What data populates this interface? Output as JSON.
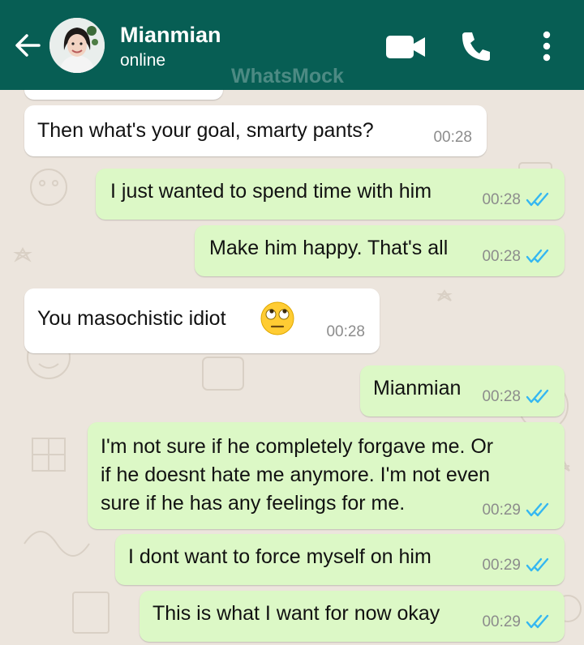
{
  "header": {
    "contact_name": "Mianmian",
    "status": "online",
    "watermark": "WhatsMock"
  },
  "icons": {
    "back": "arrow-left-icon",
    "video_call": "video-camera-icon",
    "voice_call": "phone-icon",
    "menu": "vertical-dots-menu-icon",
    "read_receipt": "double-check-icon",
    "emoji": "face-with-rolling-eyes-emoji"
  },
  "colors": {
    "header": "#075e54",
    "outgoing_bubble": "#dcf8c6",
    "incoming_bubble": "#ffffff",
    "chat_background": "#ece5dd",
    "read_ticks": "#34b7f1"
  },
  "messages": [
    {
      "direction": "in",
      "lines": [
        "Then what's your goal, smarty pants?"
      ],
      "time": "00:28"
    },
    {
      "direction": "out",
      "lines": [
        "I just wanted to spend time with him"
      ],
      "time": "00:28",
      "read": true
    },
    {
      "direction": "out",
      "lines": [
        "Make him happy. That's all"
      ],
      "time": "00:28",
      "read": true
    },
    {
      "direction": "in",
      "lines": [
        "You masochistic idiot"
      ],
      "time": "00:28",
      "emoji": "face-with-rolling-eyes"
    },
    {
      "direction": "out",
      "lines": [
        "Mianmian"
      ],
      "time": "00:28",
      "read": true
    },
    {
      "direction": "out",
      "lines": [
        "I'm not sure if he completely forgave me. Or",
        "if he doesnt hate me anymore. I'm not even",
        "sure if he has any feelings for me."
      ],
      "time": "00:29",
      "read": true
    },
    {
      "direction": "out",
      "lines": [
        "I dont want to force myself on him"
      ],
      "time": "00:29",
      "read": true
    },
    {
      "direction": "out",
      "lines": [
        "This is what I want for now okay"
      ],
      "time": "00:29",
      "read": true
    }
  ]
}
